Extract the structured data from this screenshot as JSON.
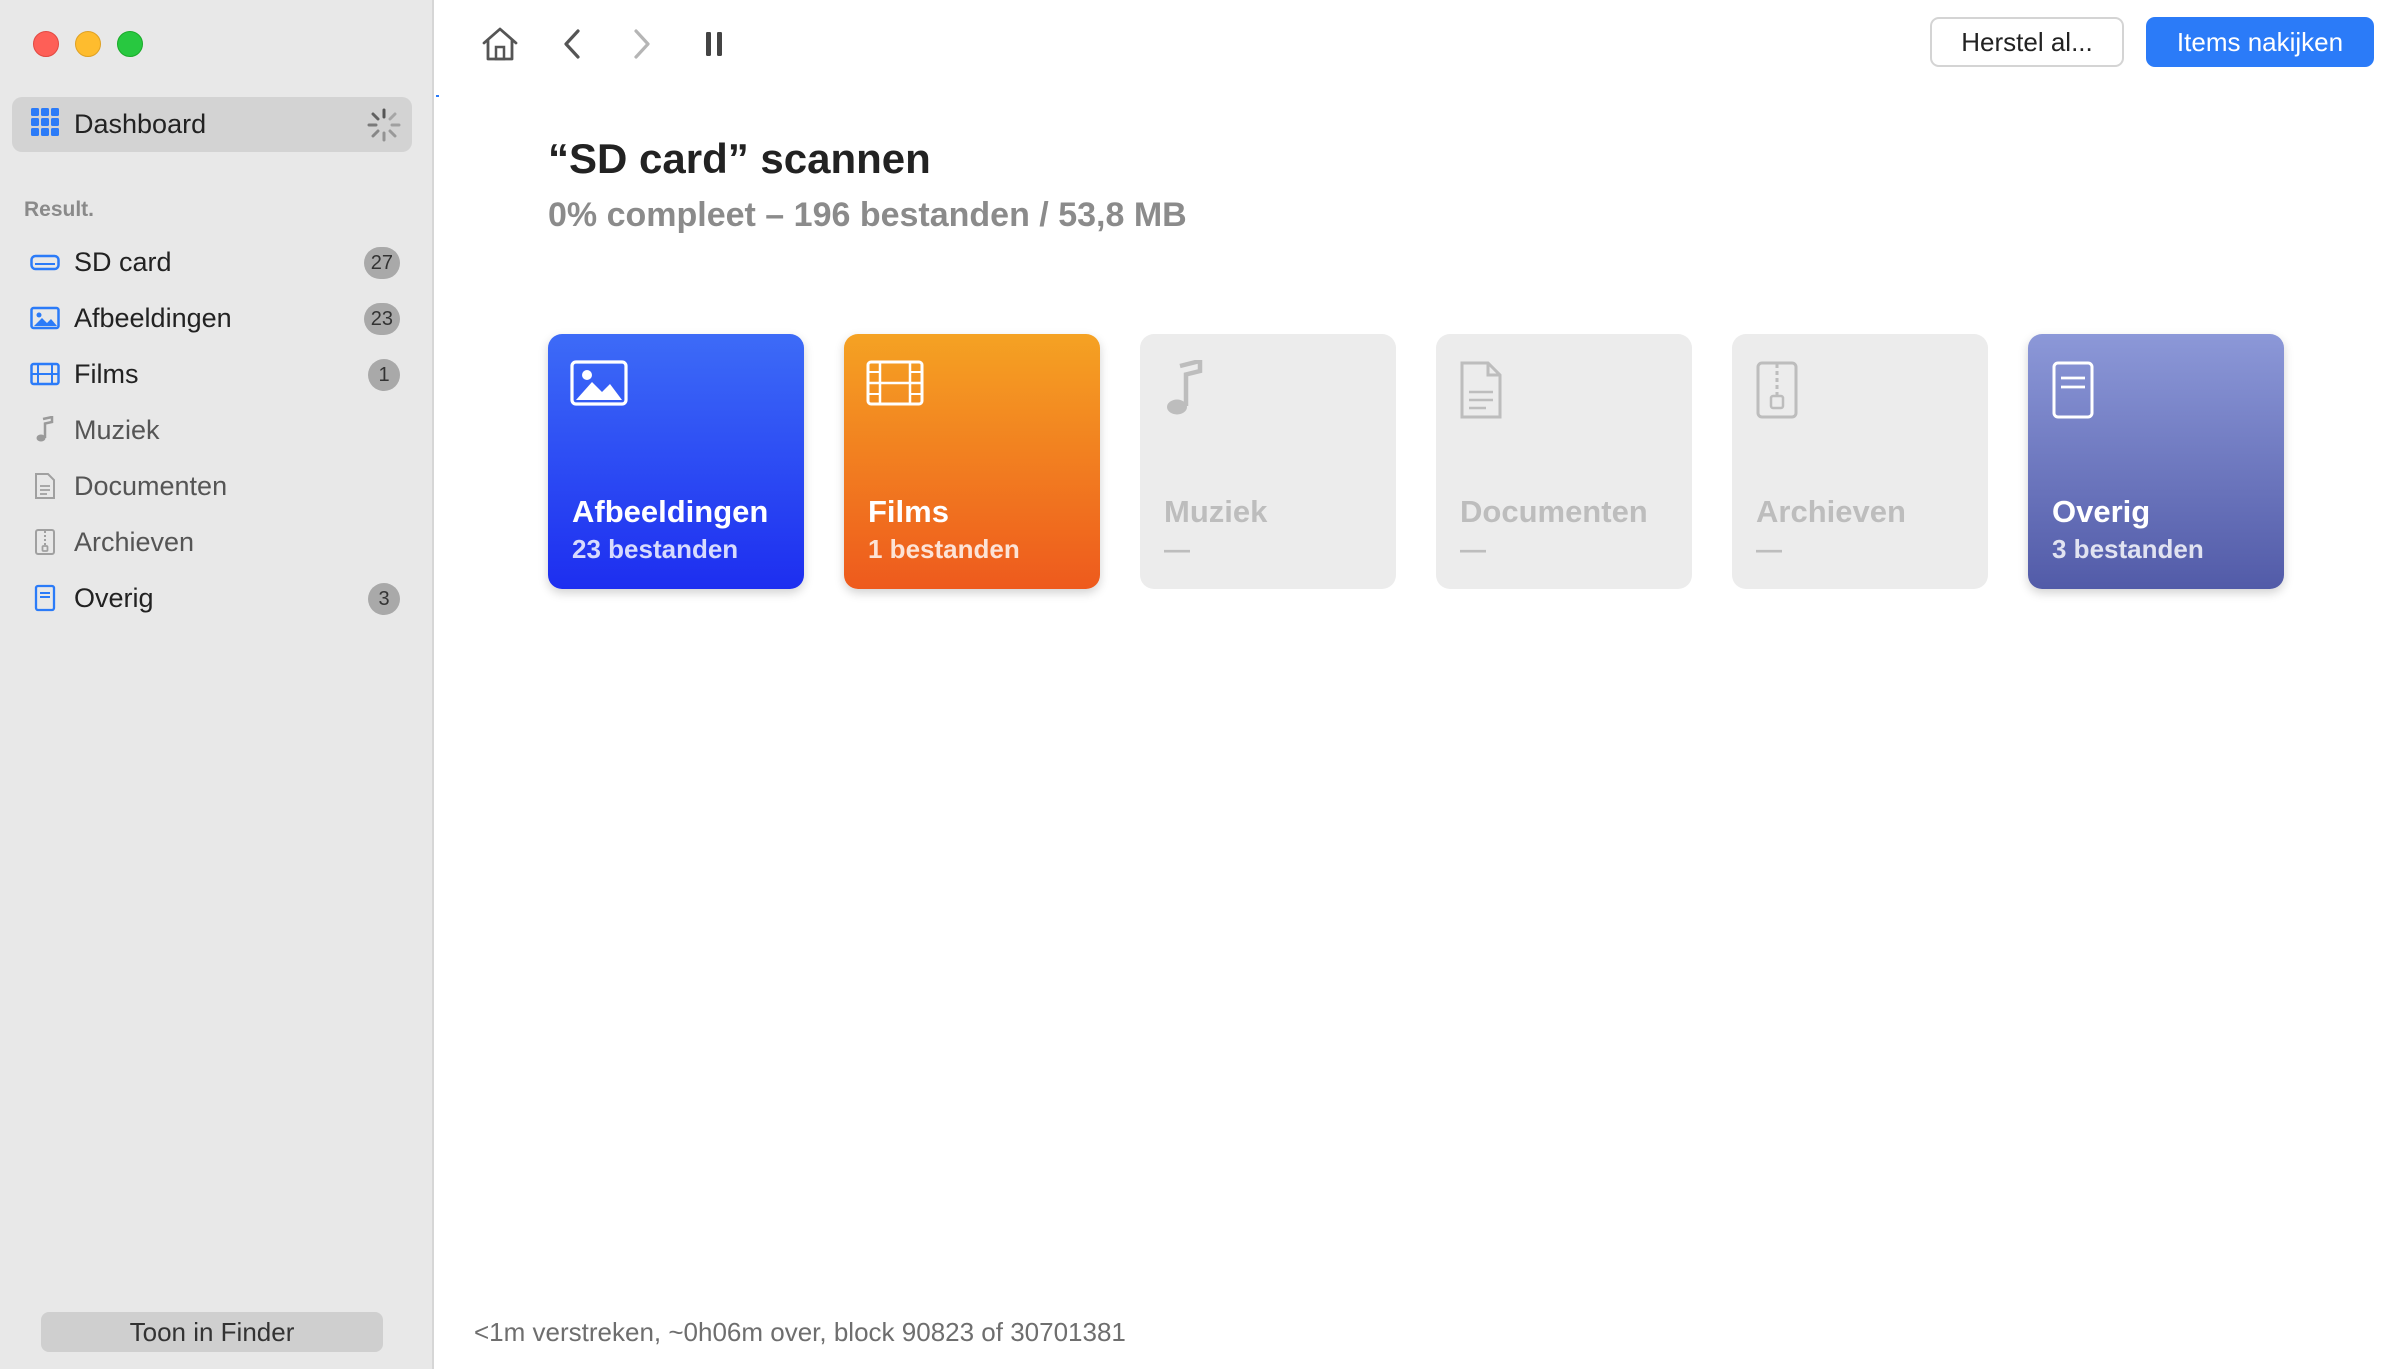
{
  "sidebar": {
    "dashboard_label": "Dashboard",
    "section_label": "Result.",
    "items": [
      {
        "label": "SD card",
        "icon": "drive-icon",
        "count": "27"
      },
      {
        "label": "Afbeeldingen",
        "icon": "image-icon",
        "count": "23"
      },
      {
        "label": "Films",
        "icon": "film-icon",
        "count": "1"
      },
      {
        "label": "Muziek",
        "icon": "music-icon",
        "count": ""
      },
      {
        "label": "Documenten",
        "icon": "document-icon",
        "count": ""
      },
      {
        "label": "Archieven",
        "icon": "archive-icon",
        "count": ""
      },
      {
        "label": "Overig",
        "icon": "other-icon",
        "count": "3"
      }
    ],
    "finder_button": "Toon in Finder"
  },
  "toolbar": {
    "restore_label": "Herstel al...",
    "review_label": "Items nakijken"
  },
  "main": {
    "title": "“SD card” scannen",
    "subtitle": "0% compleet – 196 bestanden / 53,8 MB",
    "cards": [
      {
        "label": "Afbeeldingen",
        "count": "23 bestanden",
        "icon": "image-icon"
      },
      {
        "label": "Films",
        "count": "1 bestanden",
        "icon": "film-icon"
      },
      {
        "label": "Muziek",
        "count": "—",
        "icon": "music-icon"
      },
      {
        "label": "Documenten",
        "count": "—",
        "icon": "document-icon"
      },
      {
        "label": "Archieven",
        "count": "—",
        "icon": "archive-icon"
      },
      {
        "label": "Overig",
        "count": "3 bestanden",
        "icon": "other-icon"
      }
    ],
    "status": "<1m verstreken, ~0h06m over, block 90823 of 30701381"
  },
  "colors": {
    "accent": "#2b7bf8",
    "sidebar_bg": "#e8e8e8",
    "images_card": "#1d2ef0",
    "films_card": "#ee5a1d",
    "other_card": "#525ba8"
  }
}
